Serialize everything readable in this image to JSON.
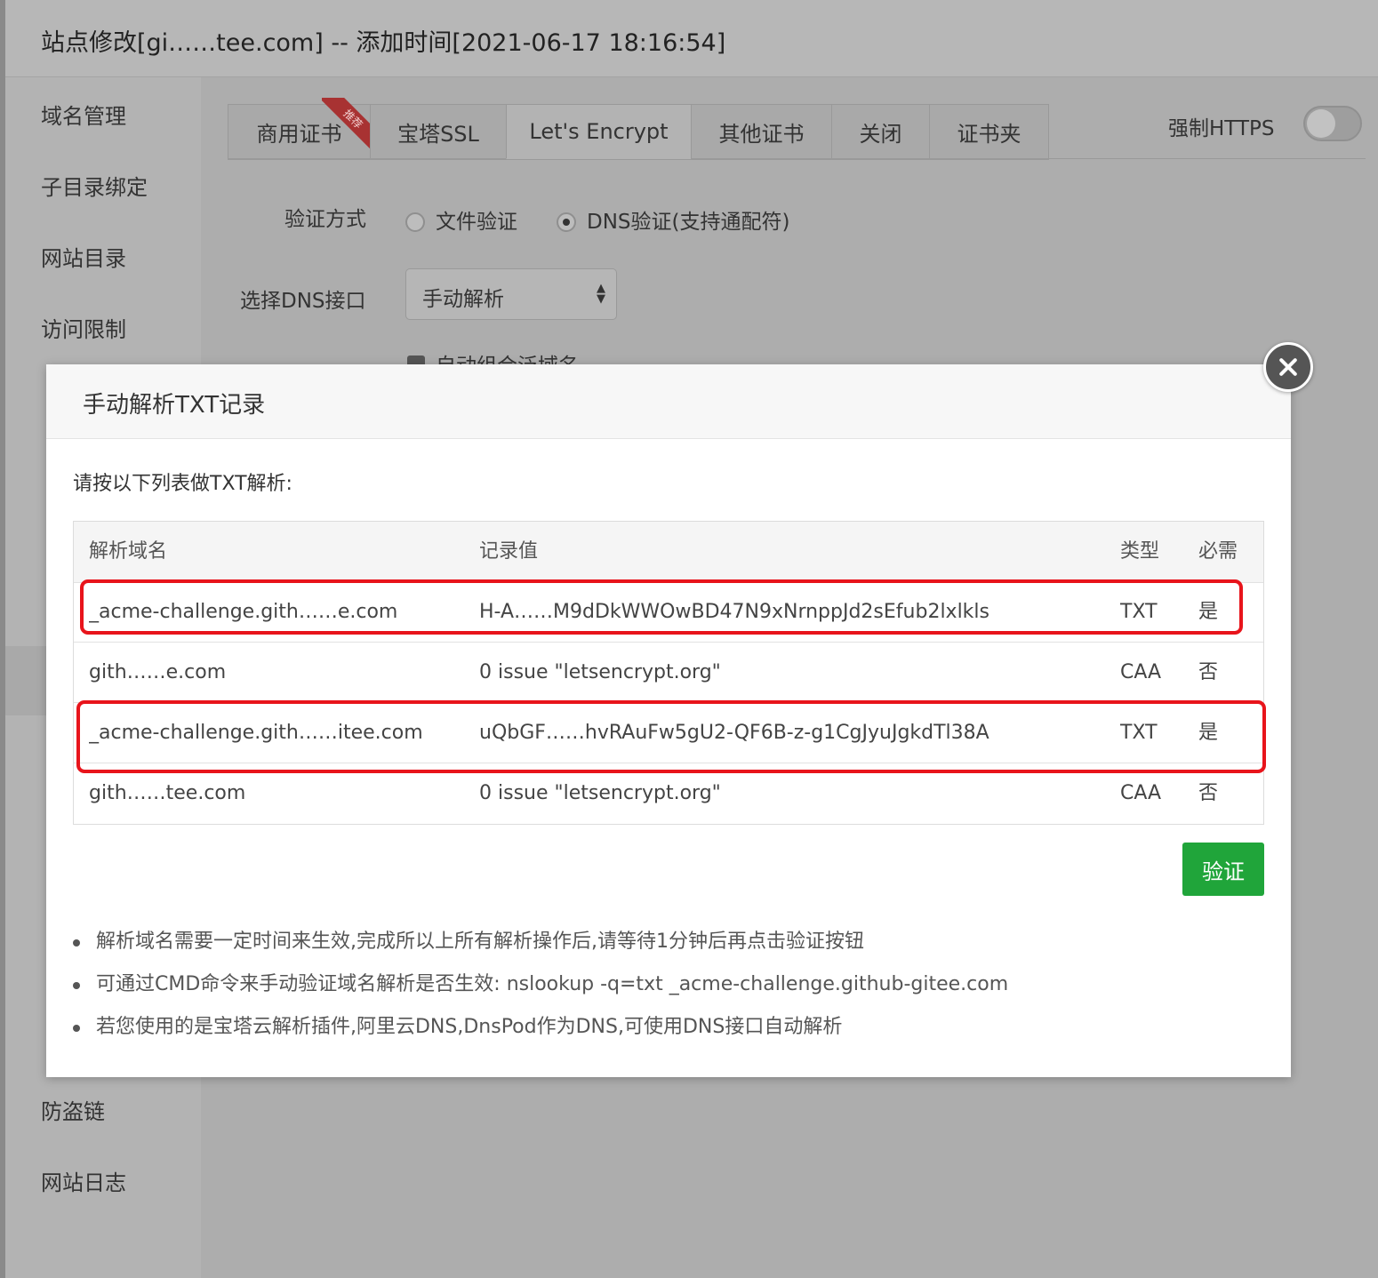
{
  "window": {
    "title": "站点修改[gi……tee.com] -- 添加时间[2021-06-17 18:16:54]"
  },
  "sidebar": {
    "items": [
      {
        "label": "域名管理"
      },
      {
        "label": "子目录绑定"
      },
      {
        "label": "网站目录"
      },
      {
        "label": "访问限制"
      },
      {
        "label": "防盗链"
      },
      {
        "label": "网站日志"
      }
    ]
  },
  "ssl_tabs": {
    "tabs": [
      {
        "label": "商用证书",
        "ribbon": "推荐"
      },
      {
        "label": "宝塔SSL"
      },
      {
        "label": "Let's Encrypt",
        "active": true
      },
      {
        "label": "其他证书"
      },
      {
        "label": "关闭"
      },
      {
        "label": "证书夹"
      }
    ],
    "force_https_label": "强制HTTPS",
    "force_https_on": false
  },
  "lets_encrypt_form": {
    "verify_method_label": "验证方式",
    "verify_options": [
      {
        "label": "文件验证",
        "selected": false
      },
      {
        "label": "DNS验证(支持通配符)",
        "selected": true
      }
    ],
    "dns_api_label": "选择DNS接口",
    "dns_api_value": "手动解析",
    "auto_combine_label": "自动组合泛域名",
    "auto_combine_checked": true
  },
  "modal": {
    "title": "手动解析TXT记录",
    "intro": "请按以下列表做TXT解析:",
    "columns": [
      "解析域名",
      "记录值",
      "类型",
      "必需"
    ],
    "rows": [
      {
        "domain": "_acme-challenge.gith……e.com",
        "value": "H-A……M9dDkWWOwBD47N9xNrnppJd2sEfub2lxlkls",
        "type": "TXT",
        "required": "是",
        "highlighted": true
      },
      {
        "domain": "gith……e.com",
        "value": "0 issue \"letsencrypt.org\"",
        "type": "CAA",
        "required": "否",
        "highlighted": false
      },
      {
        "domain": "_acme-challenge.gith……itee.com",
        "value": "uQbGF……hvRAuFw5gU2-QF6B-z-g1CgJyuJgkdTl38A",
        "type": "TXT",
        "required": "是",
        "highlighted": true
      },
      {
        "domain": "gith……tee.com",
        "value": "0 issue \"letsencrypt.org\"",
        "type": "CAA",
        "required": "否",
        "highlighted": false
      }
    ],
    "verify_button": "验证",
    "tips": [
      "解析域名需要一定时间来生效,完成所以上所有解析操作后,请等待1分钟后再点击验证按钮",
      "可通过CMD命令来手动验证域名解析是否生效: nslookup -q=txt _acme-challenge.github-gitee.com",
      "若您使用的是宝塔云解析插件,阿里云DNS,DnsPod作为DNS,可使用DNS接口自动解析"
    ]
  },
  "colors": {
    "accent_green": "#20a53a",
    "highlight_red": "#e8141b",
    "overlay_gray": "#b3b3b3"
  }
}
